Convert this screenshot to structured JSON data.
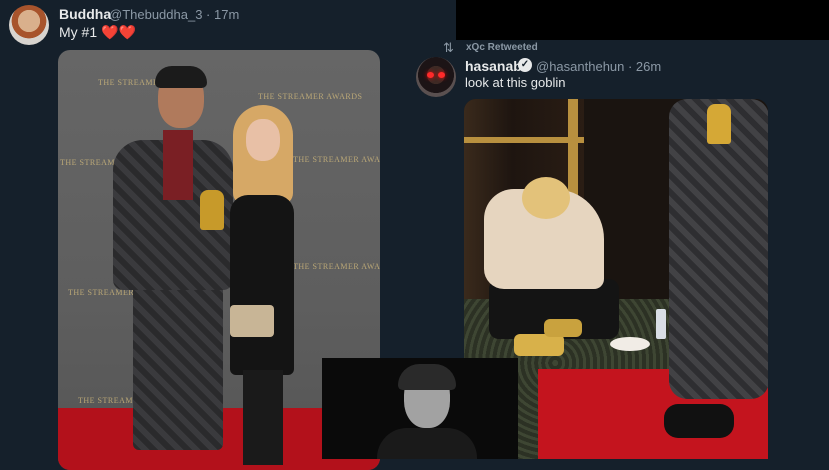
{
  "tweet1": {
    "author_name": "Buddha",
    "handle_time": "@Thebuddha_3 · 17m",
    "text": "My #1",
    "hearts": "❤️❤️"
  },
  "retweet_label": "xQc Retweeted",
  "tweet2": {
    "author_name": "hasanabi",
    "verified_mark": "✓",
    "handle_time": "@hasanthehun · 26m",
    "text": "look at this goblin"
  },
  "photo1_wall_text": "THE STREAMER AWARDS",
  "icons": [
    "retweet-icon",
    "verified-icon",
    "heart-icon"
  ],
  "colors": {
    "background": "#15202b",
    "secondary_text": "#8b98a5",
    "heart": "#f91880",
    "red_carpet": "#b3111b"
  }
}
